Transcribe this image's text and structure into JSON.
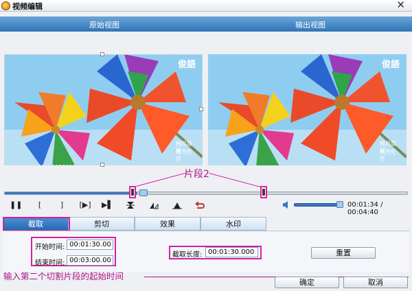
{
  "window": {
    "title": "视频编辑",
    "close_symbol": "✕"
  },
  "views": {
    "original_label": "原始视图",
    "output_label": "输出视图"
  },
  "video": {
    "watermark": "俊語",
    "subtitle_line1": "韩风版权",
    "subtitle_line2": "周杰伦作"
  },
  "annotations": {
    "segment_label": "片段2",
    "instruction": "输入第二个切割片段的起始时间"
  },
  "playback": {
    "progress_fraction": 0.33,
    "volume_fraction": 0.95,
    "current_time": "00:01:34",
    "total_time": "00:04:40",
    "time_separator": " / ",
    "controls": {
      "pause": "❚❚",
      "mark_in": "[",
      "mark_out": "]",
      "segment": "[▶]",
      "step": "▶▌"
    }
  },
  "tabs": [
    {
      "label": "截取",
      "active": true
    },
    {
      "label": "剪切",
      "active": false
    },
    {
      "label": "效果",
      "active": false
    },
    {
      "label": "水印",
      "active": false
    }
  ],
  "trim": {
    "start_label": "开始时间:",
    "start_value": "00:01:30.000",
    "end_label": "结束时间:",
    "end_value": "00:03:00.000",
    "length_label": "截取长度:",
    "length_value": "00:01:30.000",
    "reset_label": "重置"
  },
  "dialog": {
    "ok_label": "确定",
    "cancel_label": "取消"
  },
  "colors": {
    "accent": "#2f73b6",
    "annotation": "#d61fa0",
    "annotation_text": "#b0158c"
  }
}
